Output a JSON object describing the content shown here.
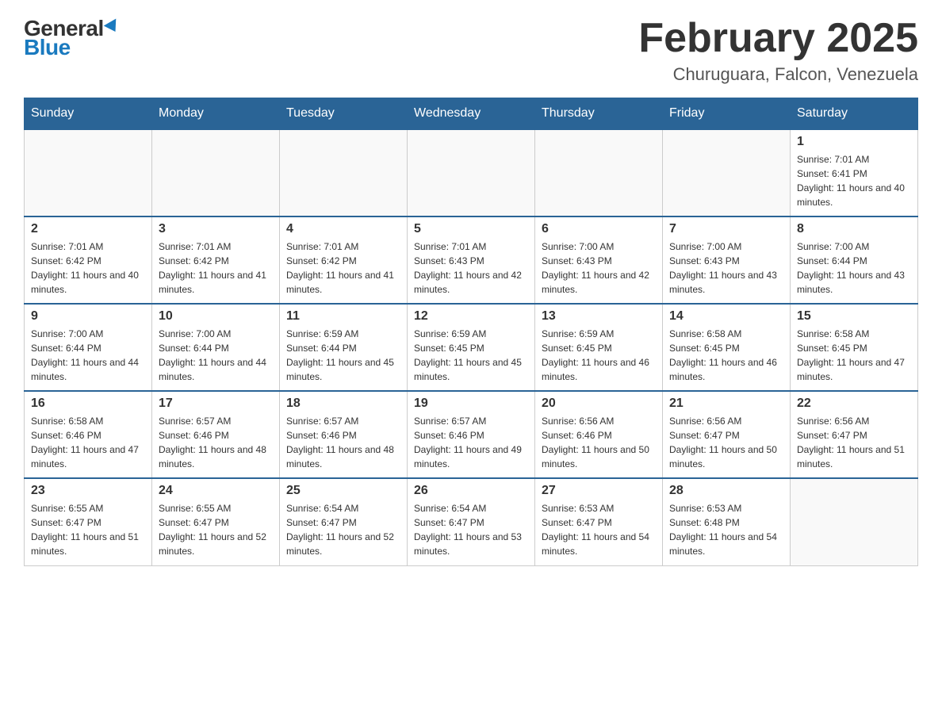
{
  "header": {
    "logo_general": "General",
    "logo_blue": "Blue",
    "month_title": "February 2025",
    "location": "Churuguara, Falcon, Venezuela"
  },
  "days_of_week": [
    "Sunday",
    "Monday",
    "Tuesday",
    "Wednesday",
    "Thursday",
    "Friday",
    "Saturday"
  ],
  "weeks": [
    [
      {
        "day": "",
        "sunrise": "",
        "sunset": "",
        "daylight": ""
      },
      {
        "day": "",
        "sunrise": "",
        "sunset": "",
        "daylight": ""
      },
      {
        "day": "",
        "sunrise": "",
        "sunset": "",
        "daylight": ""
      },
      {
        "day": "",
        "sunrise": "",
        "sunset": "",
        "daylight": ""
      },
      {
        "day": "",
        "sunrise": "",
        "sunset": "",
        "daylight": ""
      },
      {
        "day": "",
        "sunrise": "",
        "sunset": "",
        "daylight": ""
      },
      {
        "day": "1",
        "sunrise": "Sunrise: 7:01 AM",
        "sunset": "Sunset: 6:41 PM",
        "daylight": "Daylight: 11 hours and 40 minutes."
      }
    ],
    [
      {
        "day": "2",
        "sunrise": "Sunrise: 7:01 AM",
        "sunset": "Sunset: 6:42 PM",
        "daylight": "Daylight: 11 hours and 40 minutes."
      },
      {
        "day": "3",
        "sunrise": "Sunrise: 7:01 AM",
        "sunset": "Sunset: 6:42 PM",
        "daylight": "Daylight: 11 hours and 41 minutes."
      },
      {
        "day": "4",
        "sunrise": "Sunrise: 7:01 AM",
        "sunset": "Sunset: 6:42 PM",
        "daylight": "Daylight: 11 hours and 41 minutes."
      },
      {
        "day": "5",
        "sunrise": "Sunrise: 7:01 AM",
        "sunset": "Sunset: 6:43 PM",
        "daylight": "Daylight: 11 hours and 42 minutes."
      },
      {
        "day": "6",
        "sunrise": "Sunrise: 7:00 AM",
        "sunset": "Sunset: 6:43 PM",
        "daylight": "Daylight: 11 hours and 42 minutes."
      },
      {
        "day": "7",
        "sunrise": "Sunrise: 7:00 AM",
        "sunset": "Sunset: 6:43 PM",
        "daylight": "Daylight: 11 hours and 43 minutes."
      },
      {
        "day": "8",
        "sunrise": "Sunrise: 7:00 AM",
        "sunset": "Sunset: 6:44 PM",
        "daylight": "Daylight: 11 hours and 43 minutes."
      }
    ],
    [
      {
        "day": "9",
        "sunrise": "Sunrise: 7:00 AM",
        "sunset": "Sunset: 6:44 PM",
        "daylight": "Daylight: 11 hours and 44 minutes."
      },
      {
        "day": "10",
        "sunrise": "Sunrise: 7:00 AM",
        "sunset": "Sunset: 6:44 PM",
        "daylight": "Daylight: 11 hours and 44 minutes."
      },
      {
        "day": "11",
        "sunrise": "Sunrise: 6:59 AM",
        "sunset": "Sunset: 6:44 PM",
        "daylight": "Daylight: 11 hours and 45 minutes."
      },
      {
        "day": "12",
        "sunrise": "Sunrise: 6:59 AM",
        "sunset": "Sunset: 6:45 PM",
        "daylight": "Daylight: 11 hours and 45 minutes."
      },
      {
        "day": "13",
        "sunrise": "Sunrise: 6:59 AM",
        "sunset": "Sunset: 6:45 PM",
        "daylight": "Daylight: 11 hours and 46 minutes."
      },
      {
        "day": "14",
        "sunrise": "Sunrise: 6:58 AM",
        "sunset": "Sunset: 6:45 PM",
        "daylight": "Daylight: 11 hours and 46 minutes."
      },
      {
        "day": "15",
        "sunrise": "Sunrise: 6:58 AM",
        "sunset": "Sunset: 6:45 PM",
        "daylight": "Daylight: 11 hours and 47 minutes."
      }
    ],
    [
      {
        "day": "16",
        "sunrise": "Sunrise: 6:58 AM",
        "sunset": "Sunset: 6:46 PM",
        "daylight": "Daylight: 11 hours and 47 minutes."
      },
      {
        "day": "17",
        "sunrise": "Sunrise: 6:57 AM",
        "sunset": "Sunset: 6:46 PM",
        "daylight": "Daylight: 11 hours and 48 minutes."
      },
      {
        "day": "18",
        "sunrise": "Sunrise: 6:57 AM",
        "sunset": "Sunset: 6:46 PM",
        "daylight": "Daylight: 11 hours and 48 minutes."
      },
      {
        "day": "19",
        "sunrise": "Sunrise: 6:57 AM",
        "sunset": "Sunset: 6:46 PM",
        "daylight": "Daylight: 11 hours and 49 minutes."
      },
      {
        "day": "20",
        "sunrise": "Sunrise: 6:56 AM",
        "sunset": "Sunset: 6:46 PM",
        "daylight": "Daylight: 11 hours and 50 minutes."
      },
      {
        "day": "21",
        "sunrise": "Sunrise: 6:56 AM",
        "sunset": "Sunset: 6:47 PM",
        "daylight": "Daylight: 11 hours and 50 minutes."
      },
      {
        "day": "22",
        "sunrise": "Sunrise: 6:56 AM",
        "sunset": "Sunset: 6:47 PM",
        "daylight": "Daylight: 11 hours and 51 minutes."
      }
    ],
    [
      {
        "day": "23",
        "sunrise": "Sunrise: 6:55 AM",
        "sunset": "Sunset: 6:47 PM",
        "daylight": "Daylight: 11 hours and 51 minutes."
      },
      {
        "day": "24",
        "sunrise": "Sunrise: 6:55 AM",
        "sunset": "Sunset: 6:47 PM",
        "daylight": "Daylight: 11 hours and 52 minutes."
      },
      {
        "day": "25",
        "sunrise": "Sunrise: 6:54 AM",
        "sunset": "Sunset: 6:47 PM",
        "daylight": "Daylight: 11 hours and 52 minutes."
      },
      {
        "day": "26",
        "sunrise": "Sunrise: 6:54 AM",
        "sunset": "Sunset: 6:47 PM",
        "daylight": "Daylight: 11 hours and 53 minutes."
      },
      {
        "day": "27",
        "sunrise": "Sunrise: 6:53 AM",
        "sunset": "Sunset: 6:47 PM",
        "daylight": "Daylight: 11 hours and 54 minutes."
      },
      {
        "day": "28",
        "sunrise": "Sunrise: 6:53 AM",
        "sunset": "Sunset: 6:48 PM",
        "daylight": "Daylight: 11 hours and 54 minutes."
      },
      {
        "day": "",
        "sunrise": "",
        "sunset": "",
        "daylight": ""
      }
    ]
  ]
}
